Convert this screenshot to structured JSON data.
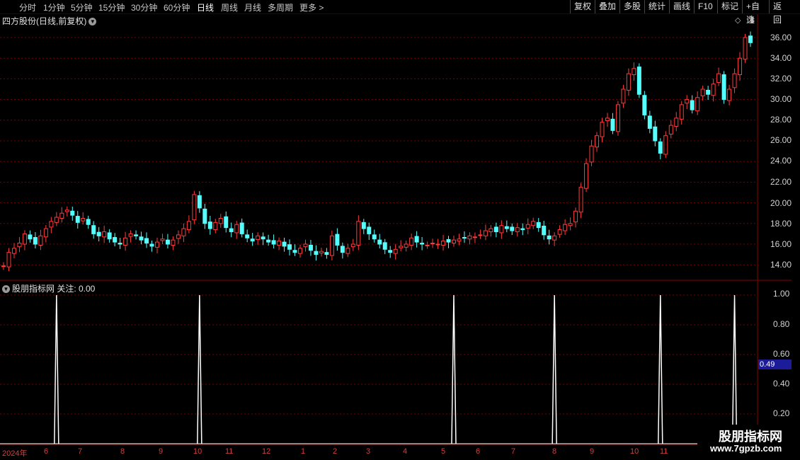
{
  "toolbar": {
    "periods": [
      "分时",
      "1分钟",
      "5分钟",
      "15分钟",
      "30分钟",
      "60分钟",
      "日线",
      "周线",
      "月线",
      "多周期",
      "更多"
    ],
    "active": "日线",
    "right_buttons": [
      "复权",
      "叠加",
      "多股",
      "统计",
      "画线",
      "F10",
      "标记",
      "+自选",
      "返回"
    ]
  },
  "main": {
    "title": "四方股份(日线,前复权)",
    "y_labels": [
      "36.00",
      "34.00",
      "32.00",
      "30.00",
      "28.00",
      "26.00",
      "24.00",
      "22.00",
      "20.00",
      "18.00",
      "16.00",
      "14.00"
    ]
  },
  "indicator": {
    "title": "股朋指标网 关注: 0.00",
    "y_labels": [
      "1.00",
      "0.80",
      "0.60",
      "0.40",
      "0.20"
    ],
    "current_value": "0.49"
  },
  "x_axis": [
    "2024年",
    "6",
    "7",
    "8",
    "9",
    "10",
    "11",
    "12",
    "1",
    "2",
    "3",
    "4",
    "5",
    "6",
    "7",
    "8",
    "9",
    "10",
    "11"
  ],
  "watermark": {
    "line1": "股朋指标网",
    "line2": "www.7gpzb.com"
  },
  "colors": {
    "up": "#ff3b3b",
    "down": "#54ffff",
    "grid": "#7a0000",
    "signal": "#ffffff"
  },
  "chart_data": [
    {
      "type": "candlestick",
      "title": "四方股份(日线,前复权)",
      "ylim": [
        13.0,
        37.0
      ],
      "close": [
        13.9,
        15.2,
        15.6,
        16.1,
        17.0,
        16.5,
        16.0,
        16.8,
        17.5,
        18.2,
        18.6,
        19.0,
        19.3,
        18.8,
        18.1,
        18.5,
        17.9,
        17.0,
        16.8,
        17.2,
        16.5,
        16.2,
        16.0,
        16.6,
        17.0,
        16.8,
        16.4,
        16.1,
        15.8,
        16.2,
        16.5,
        16.0,
        16.4,
        16.9,
        17.5,
        18.2,
        20.8,
        19.5,
        18.0,
        17.5,
        18.1,
        18.5,
        17.6,
        17.2,
        17.9,
        17.0,
        16.6,
        16.3,
        16.8,
        16.5,
        16.2,
        16.0,
        16.3,
        15.8,
        15.5,
        15.2,
        15.6,
        16.0,
        15.4,
        15.0,
        15.3,
        15.0,
        16.8,
        15.9,
        15.2,
        15.6,
        16.0,
        18.2,
        17.5,
        17.0,
        16.5,
        16.0,
        15.5,
        15.2,
        15.5,
        15.8,
        16.0,
        16.6,
        16.2,
        16.0,
        15.9,
        16.1,
        16.0,
        16.3,
        16.2,
        16.4,
        16.5,
        16.6,
        16.8,
        16.7,
        16.9,
        17.3,
        17.5,
        17.2,
        17.8,
        17.5,
        17.3,
        17.6,
        17.4,
        17.9,
        18.2,
        17.6,
        16.9,
        16.5,
        16.8,
        17.4,
        17.9,
        18.0,
        19.2,
        21.5,
        23.8,
        25.5,
        26.5,
        27.8,
        28.2,
        27.0,
        29.5,
        31.0,
        32.5,
        33.0,
        30.5,
        28.5,
        27.2,
        26.0,
        24.8,
        26.5,
        27.5,
        28.2,
        29.5,
        30.0,
        29.0,
        30.2,
        31.0,
        30.5,
        31.5,
        32.5,
        30.0,
        31.0,
        32.5,
        34.0,
        36.0,
        35.5
      ]
    },
    {
      "type": "line",
      "title": "股朋指标网 关注",
      "ylim": [
        0,
        1.05
      ],
      "signals_at_index": [
        10,
        37,
        85,
        104,
        124,
        138
      ]
    }
  ]
}
